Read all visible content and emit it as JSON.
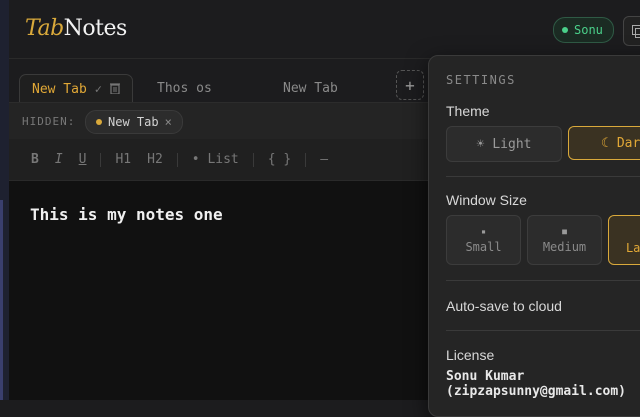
{
  "app": {
    "logo_tab": "Tab",
    "logo_notes": "Notes",
    "user_name": "Sonu"
  },
  "tabs": [
    {
      "label": "New Tab",
      "active": true
    },
    {
      "label": "Thos os",
      "active": false
    },
    {
      "label": "New Tab",
      "active": false
    }
  ],
  "tab_icons": {
    "rename": "✓",
    "delete": "🗑"
  },
  "add_tab": "+",
  "hidden": {
    "label": "HIDDEN:",
    "chip": "New Tab",
    "chip_close": "×"
  },
  "toolbar": {
    "bold": "B",
    "italic": "I",
    "underline": "U",
    "h1": "H1",
    "h2": "H2",
    "list": "• List",
    "code": "{ }",
    "divider": "—"
  },
  "editor": {
    "content": "This is my notes one"
  },
  "settings": {
    "title": "SETTINGS",
    "theme_label": "Theme",
    "theme_light": "Light",
    "theme_dark": "Dark",
    "theme_light_icon": "☀",
    "theme_dark_icon": "☾",
    "selected_theme": "Dark",
    "window_size_label": "Window Size",
    "size_small": "Small",
    "size_medium": "Medium",
    "size_large": "Large",
    "selected_size": "Large",
    "autosave_label": "Auto-save to cloud",
    "autosave_enabled": false,
    "license_label": "License",
    "license_owner": "Sonu Kumar (zipzapsunny@gmail.com)"
  },
  "colors": {
    "accent": "#e1a836",
    "online": "#4ad08a",
    "background": "#1c1c1e",
    "editor_bg": "#111111"
  }
}
